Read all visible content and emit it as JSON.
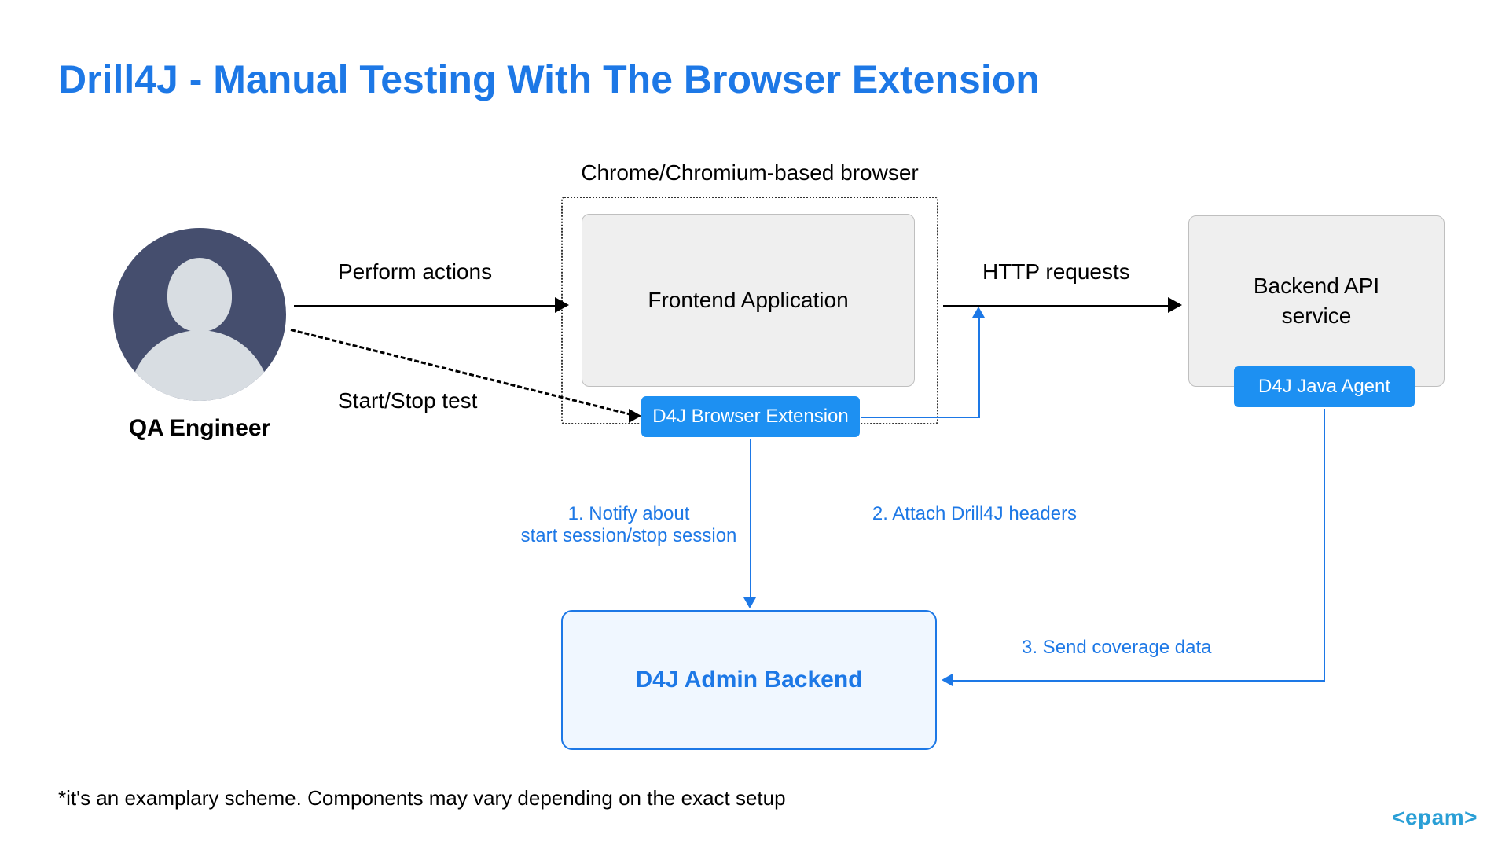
{
  "title": "Drill4J - Manual Testing With The Browser Extension",
  "actor": {
    "label": "QA Engineer"
  },
  "browser": {
    "container_label": "Chrome/Chromium-based browser",
    "frontend_label": "Frontend Application",
    "extension_label": "D4J Browser Extension"
  },
  "backend": {
    "api_label": "Backend API\nservice",
    "agent_label": "D4J Java Agent"
  },
  "admin": {
    "label": "D4J Admin Backend"
  },
  "arrows": {
    "perform_actions": "Perform actions",
    "start_stop": "Start/Stop test",
    "http_requests": "HTTP requests",
    "notify_line1": "1. Notify about",
    "notify_line2": "start session/stop session",
    "attach_headers": "2. Attach Drill4J headers",
    "send_coverage": "3. Send coverage data"
  },
  "footnote": "*it's an examplary scheme. Components may vary depending on the exact setup",
  "brand": "epam"
}
